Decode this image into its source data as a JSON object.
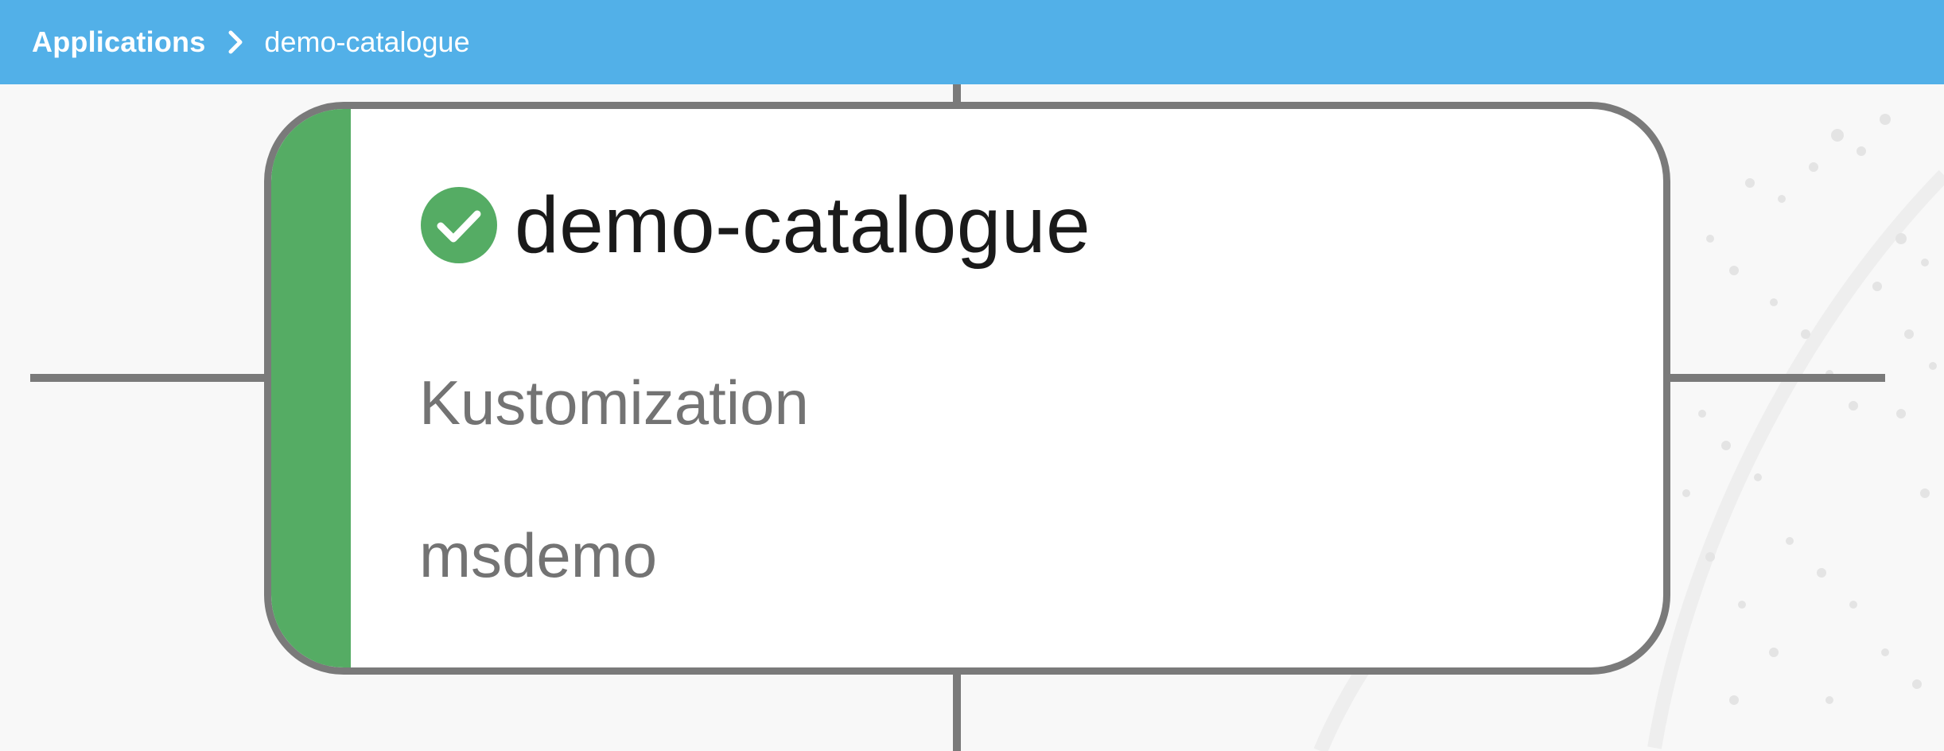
{
  "breadcrumb": {
    "root": "Applications",
    "current": "demo-catalogue"
  },
  "node": {
    "title": "demo-catalogue",
    "kind": "Kustomization",
    "namespace": "msdemo",
    "status": "ready",
    "status_icon": "check-circle-icon"
  },
  "colors": {
    "topbar": "#52b0e8",
    "status_ready": "#55ac64",
    "edge": "#7a7a7a",
    "title_text": "#1a1a1a",
    "meta_text": "#737373"
  }
}
